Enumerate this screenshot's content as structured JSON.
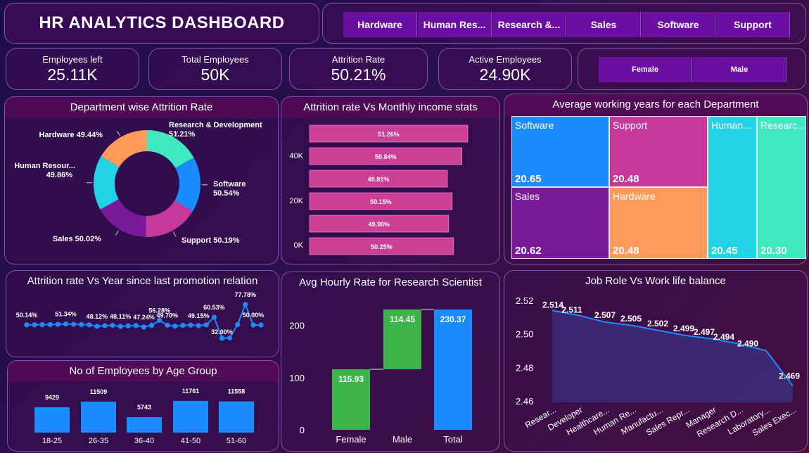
{
  "title": "HR ANALYTICS DASHBOARD",
  "dept_slicer": [
    "Hardware",
    "Human Res...",
    "Research &...",
    "Sales",
    "Software",
    "Support"
  ],
  "gender_slicer": [
    "Female",
    "Male"
  ],
  "kpis": [
    {
      "label": "Employees left",
      "value": "25.11K"
    },
    {
      "label": "Total Employees",
      "value": "50K"
    },
    {
      "label": "Attrition Rate",
      "value": "50.21%"
    },
    {
      "label": "Active Employees",
      "value": "24.90K"
    }
  ],
  "colors": {
    "teal": "#3ee8c0",
    "blue": "#1a8cff",
    "pink": "#c8389a",
    "purple": "#7a1a9a",
    "cyan": "#22d3e8",
    "orange": "#ff9a5a",
    "green": "#3cb44a",
    "bar_pink": "#cc3f95"
  },
  "chart_data": [
    {
      "id": "dept_donut",
      "type": "pie",
      "title": "Department wise Attrition Rate",
      "slices": [
        {
          "name": "Research & Development",
          "label": "51.21%",
          "share": 16.8
        },
        {
          "name": "Software",
          "label": "50.54%",
          "share": 16.6
        },
        {
          "name": "Support",
          "label": "50.19%",
          "share": 16.5
        },
        {
          "name": "Sales",
          "label": "50.02%",
          "share": 16.4
        },
        {
          "name": "Human Resour...",
          "label": "49.86%",
          "share": 16.4
        },
        {
          "name": "Hardware",
          "label": "49.44%",
          "share": 16.3
        }
      ]
    },
    {
      "id": "income_bars",
      "type": "bar",
      "title": "Attrition rate Vs Monthly income stats",
      "yticks": [
        "40K",
        "20K",
        "0K"
      ],
      "labels": [
        "51.26%",
        "50.84%",
        "49.81%",
        "50.15%",
        "49.90%",
        "50.25%"
      ],
      "values": [
        51.26,
        50.84,
        49.81,
        50.15,
        49.9,
        50.25
      ]
    },
    {
      "id": "treemap",
      "type": "heatmap",
      "title": "Average working years for each Department",
      "cells": [
        {
          "name": "Software",
          "value": "20.65"
        },
        {
          "name": "Support",
          "value": "20.48"
        },
        {
          "name": "Human...",
          "value": "20.45"
        },
        {
          "name": "Researc...",
          "value": "20.30"
        },
        {
          "name": "Sales",
          "value": "20.62"
        },
        {
          "name": "Hardware",
          "value": "20.48"
        }
      ]
    },
    {
      "id": "promotion_line",
      "type": "line",
      "title": "Attrition rate Vs Year since last promotion relation",
      "values": [
        50.14,
        50.3,
        50.5,
        50.6,
        50.9,
        51.34,
        50.9,
        50.6,
        50.3,
        48.12,
        49.0,
        49.5,
        48.11,
        48.8,
        49.2,
        47.24,
        49.5,
        56.28,
        49.7,
        48.5,
        49.4,
        49.8,
        49.15,
        50.2,
        60.53,
        32.0,
        32.5,
        50.6,
        77.78,
        50.0,
        50.0
      ],
      "labels": [
        {
          "i": 0,
          "text": "50.14%"
        },
        {
          "i": 5,
          "text": "51.34%"
        },
        {
          "i": 9,
          "text": "48.12%"
        },
        {
          "i": 12,
          "text": "48.11%"
        },
        {
          "i": 15,
          "text": "47.24%"
        },
        {
          "i": 17,
          "text": "56.28%"
        },
        {
          "i": 18,
          "text": "49.70%"
        },
        {
          "i": 22,
          "text": "49.15%"
        },
        {
          "i": 24,
          "text": "60.53%"
        },
        {
          "i": 25,
          "text": "32.00%"
        },
        {
          "i": 28,
          "text": "77.78%"
        },
        {
          "i": 29,
          "text": "50.00%"
        }
      ]
    },
    {
      "id": "age_bars",
      "type": "bar",
      "title": "No of Employees by Age Group",
      "categories": [
        "18-25",
        "26-35",
        "36-40",
        "41-50",
        "51-60"
      ],
      "values": [
        9429,
        11509,
        5743,
        11761,
        11558
      ]
    },
    {
      "id": "waterfall",
      "type": "bar",
      "title": "Avg Hourly Rate for Research Scientist",
      "categories": [
        "Female",
        "Male",
        "Total"
      ],
      "values": [
        115.93,
        114.45,
        230.37
      ],
      "yticks": [
        0,
        100,
        200
      ],
      "ylim": [
        0,
        230.37
      ]
    },
    {
      "id": "worklife_area",
      "type": "area",
      "title": "Job Role Vs Work life balance",
      "categories": [
        "Resear...",
        "Developer",
        "Healthcare...",
        "Human Re...",
        "Manufactu...",
        "Sales Repr...",
        "Manager",
        "Research D...",
        "Laboratory...",
        "Sales Exec..."
      ],
      "values": [
        2.514,
        2.511,
        2.507,
        2.505,
        2.502,
        2.499,
        2.497,
        2.494,
        2.49,
        2.469
      ],
      "yticks": [
        2.46,
        2.48,
        2.5,
        2.52
      ],
      "ylim": [
        2.46,
        2.52
      ]
    }
  ]
}
